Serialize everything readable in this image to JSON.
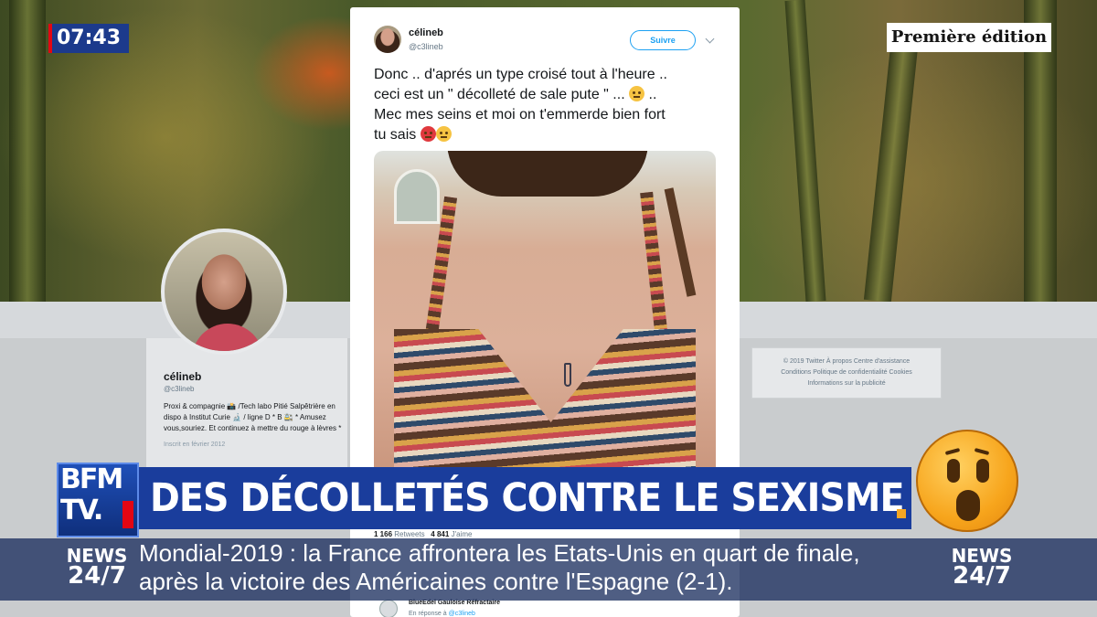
{
  "clock": "07:43",
  "show_title": "Première édition",
  "profile": {
    "name": "célineb",
    "handle": "@c3lineb",
    "bio": "Proxi & compagnie 📸 /Tech labo Pitié Salpêtrière en dispo à Institut Curie 🔬 / ligne D * B 🚉 * Amusez vous,souriez. Et continuez à mettre du rouge à lèvres *",
    "joined": "Inscrit en février 2012"
  },
  "footer_links": {
    "line1": "© 2019 Twitter   À propos   Centre d'assistance",
    "line2": "Conditions   Politique de confidentialité   Cookies",
    "line3": "Informations sur la publicité"
  },
  "tweet": {
    "name": "célineb",
    "handle": "@c3lineb",
    "follow_label": "Suivre",
    "text_line1": "Donc .. d'aprés un type croisé tout à l'heure ..",
    "text_line2": "ceci est un \" décolleté de sale pute \" ...",
    "text_line2_end": "..",
    "text_line3": "Mec mes seins et moi on t'emmerde bien fort",
    "text_line4": "tu sais",
    "retweets": "1 166",
    "retweets_label": "Retweets",
    "likes": "4 841",
    "likes_label": "J'aime"
  },
  "reply": {
    "name": "BlueEdel    Gauloise Réfractaire",
    "in_reply_prefix": "En réponse à",
    "in_reply_handle": "@c3lineb"
  },
  "channel_logo": {
    "line1": "BFM",
    "line2": "TV."
  },
  "headline": "DES DÉCOLLETÉS CONTRE LE SEXISME",
  "news_label": {
    "line1": "NEWS",
    "line2": "24/7"
  },
  "ticker": {
    "line1": "Mondial-2019 : la France affrontera les Etats-Unis en quart de finale,",
    "line2": "après la victoire des Américaines contre l'Espagne (2-1)."
  },
  "icons": [
    "chevron-down-icon",
    "thinking-emoji-icon",
    "angry-emoji-icon",
    "eye-roll-emoji-icon",
    "shocked-emoji-icon"
  ],
  "colors": {
    "bfm_blue": "#1a3d9c",
    "bfm_red": "#e30613",
    "twitter_blue": "#1da1f2",
    "accent_orange": "#f5a623"
  }
}
